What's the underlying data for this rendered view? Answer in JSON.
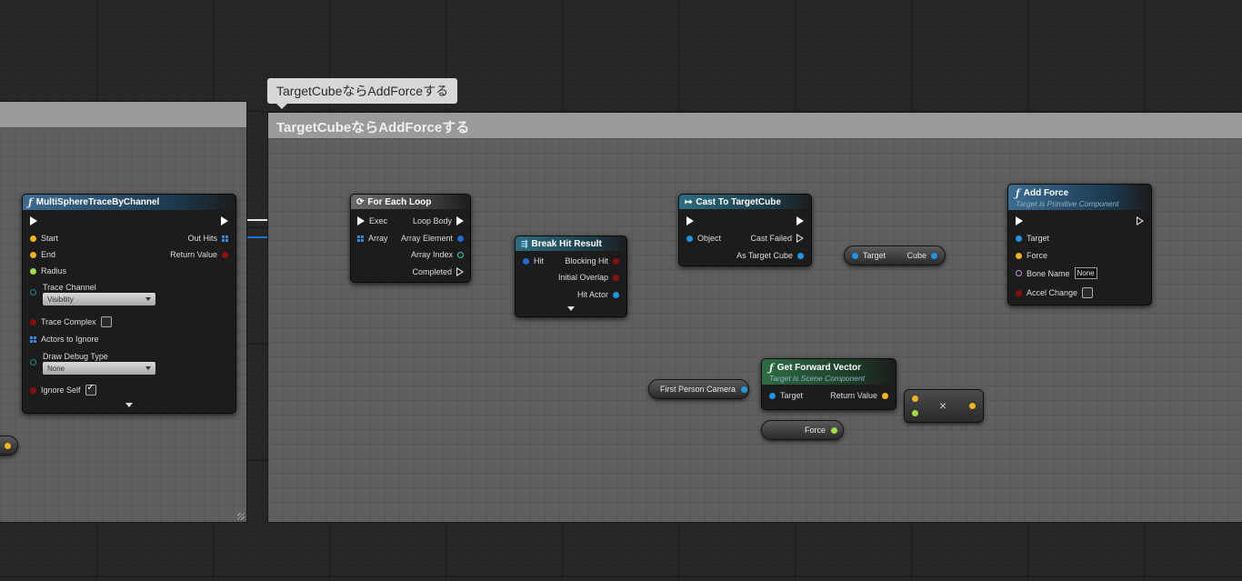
{
  "comment": {
    "title": "TargetCubeならAddForceする",
    "bubble": "TargetCubeならAddForceする"
  },
  "multi_sphere": {
    "title": "MultiSphereTraceByChannel",
    "start": "Start",
    "end": "End",
    "radius": "Radius",
    "trace_channel": "Trace Channel",
    "trace_channel_value": "Visibility",
    "trace_complex": "Trace Complex",
    "actors_to_ignore": "Actors to Ignore",
    "draw_debug_type": "Draw Debug Type",
    "draw_debug_value": "None",
    "ignore_self": "Ignore Self",
    "out_hits": "Out Hits",
    "return_value": "Return Value"
  },
  "for_each": {
    "title": "For Each Loop",
    "exec": "Exec",
    "array": "Array",
    "loop_body": "Loop Body",
    "array_element": "Array Element",
    "array_index": "Array Index",
    "completed": "Completed"
  },
  "break_hit": {
    "title": "Break Hit Result",
    "hit": "Hit",
    "blocking_hit": "Blocking Hit",
    "initial_overlap": "Initial Overlap",
    "hit_actor": "Hit Actor"
  },
  "cast": {
    "title": "Cast To TargetCube",
    "object": "Object",
    "cast_failed": "Cast Failed",
    "as_target_cube": "As Target Cube"
  },
  "target_cube_node": {
    "in": "Target",
    "out": "Cube"
  },
  "add_force": {
    "title": "Add Force",
    "subtitle": "Target is Primitive Component",
    "target": "Target",
    "force": "Force",
    "bone_name": "Bone Name",
    "bone_name_value": "None",
    "accel_change": "Accel Change"
  },
  "get_forward": {
    "title": "Get Forward Vector",
    "subtitle": "Target is Scene Component",
    "target": "Target",
    "return_value": "Return Value"
  },
  "camera_var": {
    "label": "First Person Camera"
  },
  "force_var": {
    "label": "Force"
  },
  "multiply": {
    "symbol": "×"
  },
  "colors": {
    "exec": "#ffffff",
    "object": "#1f95e6",
    "vector": "#f2b41c",
    "float": "#9be04b",
    "bool": "#8c0f0f",
    "name": "#c98ee6",
    "int": "#31d1b0"
  }
}
